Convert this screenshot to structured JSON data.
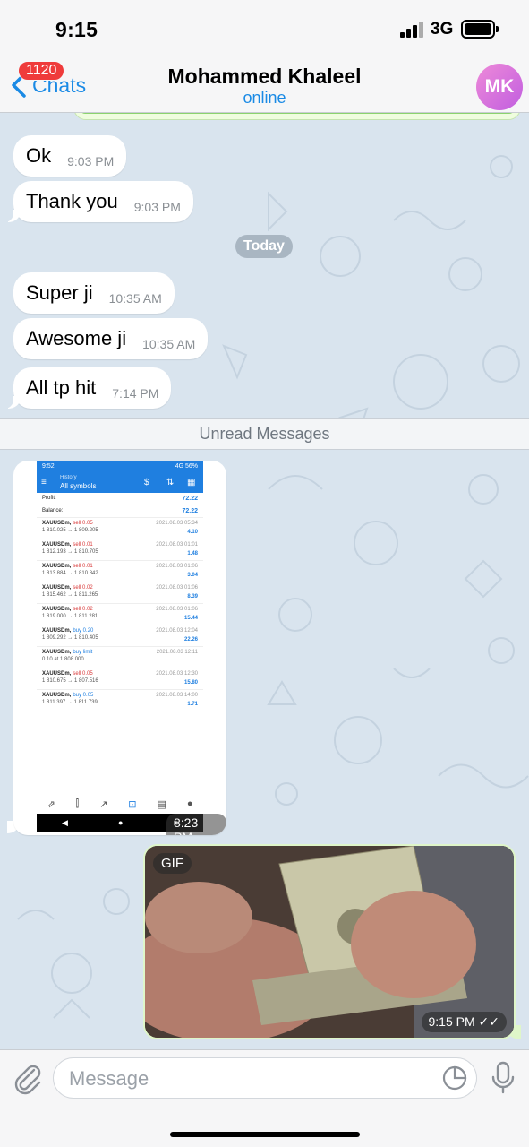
{
  "status": {
    "time": "9:15",
    "network": "3G"
  },
  "header": {
    "back_label": "Chats",
    "unread_badge": "1120",
    "contact_name": "Mohammed Khaleel",
    "contact_status": "online",
    "avatar_initials": "MK"
  },
  "messages": [
    {
      "text": "Ok",
      "time": "9:03 PM"
    },
    {
      "text": "Thank you",
      "time": "9:03 PM"
    },
    {
      "text": "Super ji",
      "time": "10:35 AM"
    },
    {
      "text": "Awesome ji",
      "time": "10:35 AM"
    },
    {
      "text": "All tp hit",
      "time": "7:14 PM"
    }
  ],
  "day_separator": "Today",
  "unread_separator": "Unread Messages",
  "photo_message": {
    "time": "8:23 PM",
    "status_time": "9:52",
    "status_right": "4G 56%",
    "header_small": "History",
    "header_title": "All symbols",
    "profit_label": "Profit:",
    "profit_value": "72.22",
    "balance_label": "Balance:",
    "balance_value": "72.22",
    "trades": [
      {
        "symbol": "XAUUSDm,",
        "action": "sell 0.05",
        "side": "sell",
        "prices": "1 810.025 → 1 809.205",
        "date": "2021.08.03 05:34",
        "profit": "4.10"
      },
      {
        "symbol": "XAUUSDm,",
        "action": "sell 0.01",
        "side": "sell",
        "prices": "1 812.193 → 1 810.705",
        "date": "2021.08.03 01:01",
        "profit": "1.48"
      },
      {
        "symbol": "XAUUSDm,",
        "action": "sell 0.01",
        "side": "sell",
        "prices": "1 813.884 → 1 810.842",
        "date": "2021.08.03 01:06",
        "profit": "3.04"
      },
      {
        "symbol": "XAUUSDm,",
        "action": "sell 0.02",
        "side": "sell",
        "prices": "1 815.462 → 1 811.265",
        "date": "2021.08.03 01:06",
        "profit": "8.39"
      },
      {
        "symbol": "XAUUSDm,",
        "action": "sell 0.02",
        "side": "sell",
        "prices": "1 819.000 → 1 811.281",
        "date": "2021.08.03 01:06",
        "profit": "15.44"
      },
      {
        "symbol": "XAUUSDm,",
        "action": "buy 0.20",
        "side": "buy",
        "prices": "1 809.292 → 1 810.405",
        "date": "2021.08.03 12:04",
        "profit": "22.26"
      },
      {
        "symbol": "XAUUSDm,",
        "action": "buy limit",
        "side": "buy",
        "prices": "0.10 at 1 808.000",
        "date": "2021.08.03 12:11",
        "profit": ""
      },
      {
        "symbol": "XAUUSDm,",
        "action": "sell 0.05",
        "side": "sell",
        "prices": "1 810.675 → 1 807.516",
        "date": "2021.08.03 12:30",
        "profit": "15.80"
      },
      {
        "symbol": "XAUUSDm,",
        "action": "buy 0.05",
        "side": "buy",
        "prices": "1 811.397 → 1 811.739",
        "date": "2021.08.03 14:00",
        "profit": "1.71"
      }
    ]
  },
  "gif_message": {
    "tag": "GIF",
    "time": "9:15 PM ✓✓"
  },
  "composer": {
    "placeholder": "Message"
  },
  "icons": {
    "back": "chevron-left-icon",
    "attach": "paperclip-icon",
    "sticker": "sticker-icon",
    "mic": "microphone-icon"
  },
  "colors": {
    "accent": "#1a8ae5",
    "badge": "#ef3b3b",
    "chat_bg": "#d9e4ee",
    "outgoing": "#effdde"
  }
}
